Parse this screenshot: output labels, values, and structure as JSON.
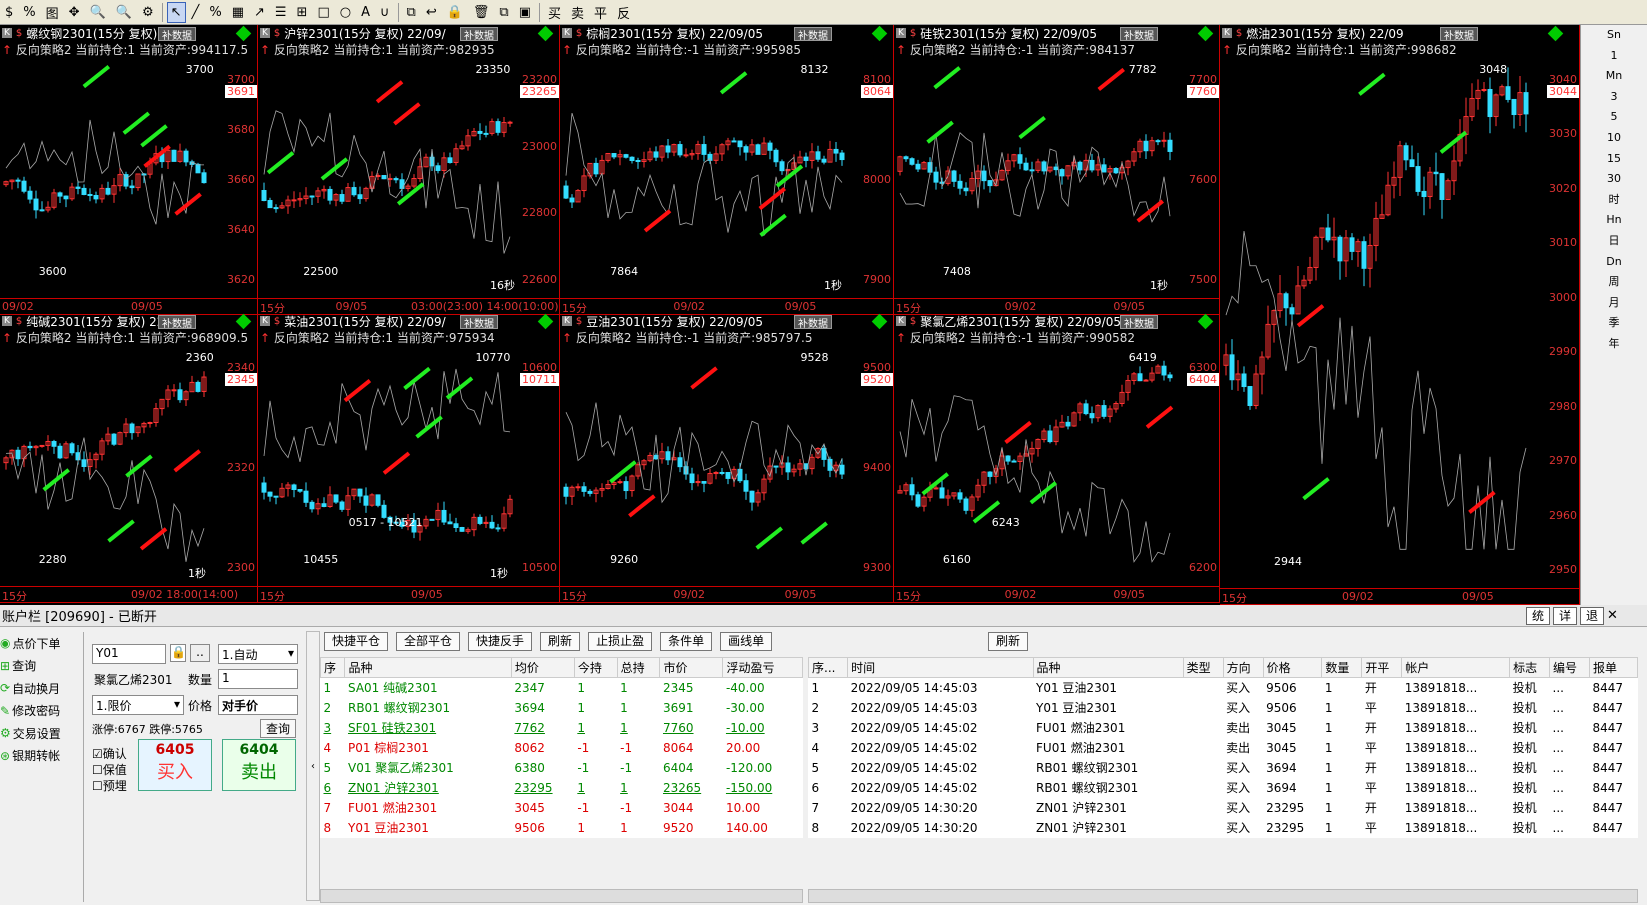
{
  "toolbar": {
    "items": [
      "$",
      "%",
      "图",
      "✥",
      "🔍",
      "🔍",
      "⚙",
      "↖",
      "╱",
      "%",
      "▦",
      "↗",
      "☰",
      "⊞",
      "□",
      "○",
      "A",
      "∪",
      "⧉",
      "↩",
      "🔒",
      "🗑",
      "⧉",
      "▣",
      "买",
      "卖",
      "平",
      "反"
    ]
  },
  "panels": [
    {
      "title": "螺纹钢2301(15分  复权)  22/",
      "bu": "补数据",
      "stat": "反向策略2  当前持仓:1  当前资产:994117.5",
      "hi": "3700",
      "lo": "3600",
      "tag": "3691",
      "ticks": [
        "3700",
        "3680",
        "3660",
        "3640",
        "3620"
      ],
      "x": [
        "09/02",
        "09/05"
      ],
      "extra": "",
      "sec": ""
    },
    {
      "title": "沪锌2301(15分  复权)  22/09/",
      "bu": "补数据",
      "stat": "反向策略2  当前持仓:1  当前资产:982935",
      "hi": "23350",
      "lo": "22500",
      "tag": "23265",
      "ticks": [
        "23200",
        "23000",
        "22800",
        "22600"
      ],
      "x": [
        "15分",
        "09/05",
        "03:00(23:00)",
        "14:00(10:00)"
      ],
      "extra": "",
      "sec": "16秒"
    },
    {
      "title": "棕榈2301(15分  复权)  22/09/05",
      "bu": "补数据",
      "stat": "反向策略2  当前持仓:-1  当前资产:995985",
      "hi": "8132",
      "lo": "7864",
      "tag": "8064",
      "ticks": [
        "8100",
        "8000",
        "7900"
      ],
      "x": [
        "15分",
        "09/02",
        "09/05"
      ],
      "extra": "",
      "sec": "1秒"
    },
    {
      "title": "硅铁2301(15分  复权)  22/09/05",
      "bu": "补数据",
      "stat": "反向策略2  当前持仓:-1  当前资产:984137",
      "hi": "7782",
      "lo": "7408",
      "tag": "7760",
      "ticks": [
        "7700",
        "7600",
        "7500"
      ],
      "x": [
        "15分",
        "09/02",
        "09/05"
      ],
      "extra": "",
      "sec": "1秒"
    },
    {
      "title": "燃油2301(15分  复权)  22/09",
      "bu": "补数据",
      "stat": "反向策略2  当前持仓:1  当前资产:998682",
      "hi": "3048",
      "lo": "2944",
      "tag": "3044",
      "ticks": [
        "3040",
        "3030",
        "3020",
        "3010",
        "3000",
        "2990",
        "2980",
        "2970",
        "2960",
        "2950"
      ],
      "x": [
        "15分",
        "09/02",
        "09/05"
      ],
      "extra": "",
      "sec": ""
    },
    {
      "title": "纯碱2301(15分  复权)  22/09",
      "bu": "补数据",
      "stat": "反向策略2  当前持仓:1  当前资产:968909.5",
      "hi": "2360",
      "lo": "2280",
      "tag": "2345",
      "ticks": [
        "2340",
        "2320",
        "2300"
      ],
      "x": [
        "15分",
        "09/02  18:00(14:00)"
      ],
      "extra": "",
      "sec": "1秒"
    },
    {
      "title": "菜油2301(15分  复权)  22/09/",
      "bu": "补数据",
      "stat": "反向策略2  当前持仓:1  当前资产:975934",
      "hi": "10770",
      "lo": "10455",
      "tag": "10711",
      "ticks": [
        "10600",
        "10500"
      ],
      "x": [
        "15分",
        "09/05"
      ],
      "extra": "0517 - 10521",
      "sec": "1秒"
    },
    {
      "title": "豆油2301(15分  复权)  22/09/05",
      "bu": "补数据",
      "stat": "反向策略2  当前持仓:-1  当前资产:985797.5",
      "hi": "9528",
      "lo": "9260",
      "tag": "9520",
      "ticks": [
        "9500",
        "9400",
        "9300"
      ],
      "x": [
        "15分",
        "09/02",
        "09/05"
      ],
      "extra": "",
      "sec": ""
    },
    {
      "title": "聚氯乙烯2301(15分  复权)  22/09/05",
      "bu": "补数据",
      "stat": "反向策略2  当前持仓:-1  当前资产:990582",
      "hi": "6419",
      "lo": "6160",
      "tag": "6404",
      "ticks": [
        "6300",
        "6200"
      ],
      "x": [
        "15分",
        "09/02",
        "09/05"
      ],
      "extra": "6243",
      "sec": ""
    }
  ],
  "rightscroll": [
    "Sn",
    "1",
    "Mn",
    "3",
    "5",
    "10",
    "15",
    "30",
    "时",
    "Hn",
    "日",
    "Dn",
    "周",
    "月",
    "季",
    "年"
  ],
  "account": {
    "title": "账户栏 [209690]  - 已断开",
    "btns": [
      "统",
      "详",
      "退"
    ],
    "nav": [
      "点价下单",
      "查询",
      "自动换月",
      "修改密码",
      "交易设置",
      "银期转帐"
    ],
    "code": "Y01",
    "mode": "1.自动",
    "name": "聚氯乙烯2301",
    "qty_label": "数量",
    "qty": "1",
    "pricetype": "1.限价",
    "price_label": "价格",
    "price": "对手价",
    "limits": "涨停:6767  跌停:5765",
    "query": "查询",
    "checks": [
      "确认",
      "保值",
      "预埋"
    ],
    "buy_price": "6405",
    "buy_label": "买入",
    "sell_price": "6404",
    "sell_label": "卖出"
  },
  "positions": {
    "btns": [
      "快捷平仓",
      "全部平仓",
      "快捷反手",
      "刷新",
      "止损止盈",
      "条件单",
      "画线单"
    ],
    "headers": [
      "序",
      "品种",
      "均价",
      "今持",
      "总持",
      "市价",
      "浮动盈亏"
    ],
    "rows": [
      [
        "1",
        "SA01 纯碱2301",
        "2347",
        "1",
        "1",
        "2345",
        "-40.00"
      ],
      [
        "2",
        "RB01 螺纹钢2301",
        "3694",
        "1",
        "1",
        "3691",
        "-30.00"
      ],
      [
        "3",
        "SF01 硅铁2301",
        "7762",
        "1",
        "1",
        "7760",
        "-10.00"
      ],
      [
        "4",
        "P01 棕榈2301",
        "8062",
        "-1",
        "-1",
        "8064",
        "20.00"
      ],
      [
        "5",
        "V01 聚氯乙烯2301",
        "6380",
        "-1",
        "-1",
        "6404",
        "-120.00"
      ],
      [
        "6",
        "ZN01 沪锌2301",
        "23295",
        "1",
        "1",
        "23265",
        "-150.00"
      ],
      [
        "7",
        "FU01 燃油2301",
        "3045",
        "-1",
        "-1",
        "3044",
        "10.00"
      ],
      [
        "8",
        "Y01 豆油2301",
        "9506",
        "1",
        "1",
        "9520",
        "140.00"
      ]
    ]
  },
  "trades": {
    "refresh": "刷新",
    "headers": [
      "序...",
      "时间",
      "品种",
      "类型",
      "方向",
      "价格",
      "数量",
      "开平",
      "帐户",
      "标志",
      "编号",
      "报单"
    ],
    "rows": [
      [
        "1",
        "2022/09/05 14:45:03",
        "Y01 豆油2301",
        "",
        "买入",
        "9506",
        "1",
        "开",
        "13891818...",
        "投机",
        "...",
        "8447"
      ],
      [
        "2",
        "2022/09/05 14:45:03",
        "Y01 豆油2301",
        "",
        "买入",
        "9506",
        "1",
        "平",
        "13891818...",
        "投机",
        "...",
        "8447"
      ],
      [
        "3",
        "2022/09/05 14:45:02",
        "FU01 燃油2301",
        "",
        "卖出",
        "3045",
        "1",
        "开",
        "13891818...",
        "投机",
        "...",
        "8447"
      ],
      [
        "4",
        "2022/09/05 14:45:02",
        "FU01 燃油2301",
        "",
        "卖出",
        "3045",
        "1",
        "平",
        "13891818...",
        "投机",
        "...",
        "8447"
      ],
      [
        "5",
        "2022/09/05 14:45:02",
        "RB01 螺纹钢2301",
        "",
        "买入",
        "3694",
        "1",
        "开",
        "13891818...",
        "投机",
        "...",
        "8447"
      ],
      [
        "6",
        "2022/09/05 14:45:02",
        "RB01 螺纹钢2301",
        "",
        "买入",
        "3694",
        "1",
        "平",
        "13891818...",
        "投机",
        "...",
        "8447"
      ],
      [
        "7",
        "2022/09/05 14:30:20",
        "ZN01 沪锌2301",
        "",
        "买入",
        "23295",
        "1",
        "开",
        "13891818...",
        "投机",
        "...",
        "8447"
      ],
      [
        "8",
        "2022/09/05 14:30:20",
        "ZN01 沪锌2301",
        "",
        "买入",
        "23295",
        "1",
        "平",
        "13891818...",
        "投机",
        "...",
        "8447"
      ]
    ]
  }
}
